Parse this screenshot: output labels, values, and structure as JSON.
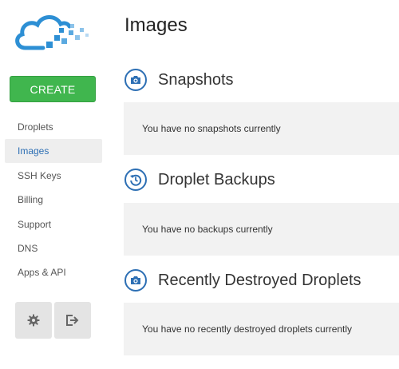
{
  "sidebar": {
    "create_label": "CREATE",
    "items": [
      {
        "label": "Droplets",
        "active": false
      },
      {
        "label": "Images",
        "active": true
      },
      {
        "label": "SSH Keys",
        "active": false
      },
      {
        "label": "Billing",
        "active": false
      },
      {
        "label": "Support",
        "active": false
      },
      {
        "label": "DNS",
        "active": false
      },
      {
        "label": "Apps & API",
        "active": false
      }
    ],
    "bottom_icons": [
      "gear-icon",
      "logout-icon"
    ]
  },
  "main": {
    "title": "Images",
    "sections": [
      {
        "title": "Snapshots",
        "icon": "camera-icon",
        "message": "You have no snapshots currently"
      },
      {
        "title": "Droplet Backups",
        "icon": "history-icon",
        "message": "You have no backups currently"
      },
      {
        "title": "Recently Destroyed Droplets",
        "icon": "camera-icon",
        "message": "You have no recently destroyed droplets currently"
      }
    ]
  },
  "colors": {
    "accent": "#2d6fb4",
    "create_green": "#40b64e",
    "panel_bg": "#f2f2f2",
    "active_nav_bg": "#eeeeee"
  }
}
